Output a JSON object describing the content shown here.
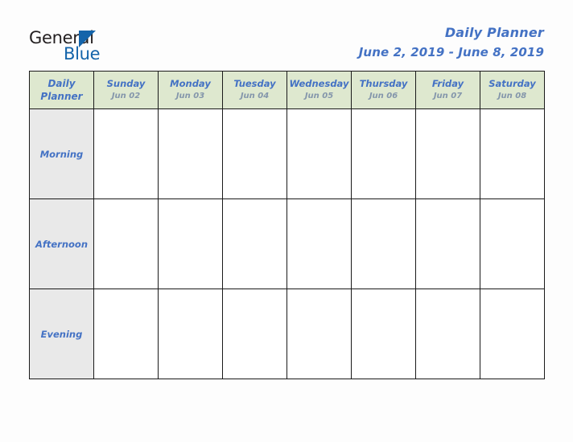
{
  "brand": {
    "name_dark": "General",
    "name_blue": "Blue",
    "triangle_color": "#1464aa",
    "dark_color": "#231f20"
  },
  "header": {
    "title": "Daily Planner",
    "date_range": "June 2, 2019 - June 8, 2019",
    "title_color": "#4472c4"
  },
  "table": {
    "corner": {
      "line1": "Daily",
      "line2": "Planner"
    },
    "header_bg": "#dee8cf",
    "label_bg": "#e9e9e9",
    "border_color": "#1a1a1a",
    "columns": [
      {
        "day": "Sunday",
        "date": "Jun 02"
      },
      {
        "day": "Monday",
        "date": "Jun 03"
      },
      {
        "day": "Tuesday",
        "date": "Jun 04"
      },
      {
        "day": "Wednesday",
        "date": "Jun 05"
      },
      {
        "day": "Thursday",
        "date": "Jun 06"
      },
      {
        "day": "Friday",
        "date": "Jun 07"
      },
      {
        "day": "Saturday",
        "date": "Jun 08"
      }
    ],
    "rows": [
      {
        "label": "Morning",
        "cells": [
          "",
          "",
          "",
          "",
          "",
          "",
          ""
        ]
      },
      {
        "label": "Afternoon",
        "cells": [
          "",
          "",
          "",
          "",
          "",
          "",
          ""
        ]
      },
      {
        "label": "Evening",
        "cells": [
          "",
          "",
          "",
          "",
          "",
          "",
          ""
        ]
      }
    ]
  }
}
